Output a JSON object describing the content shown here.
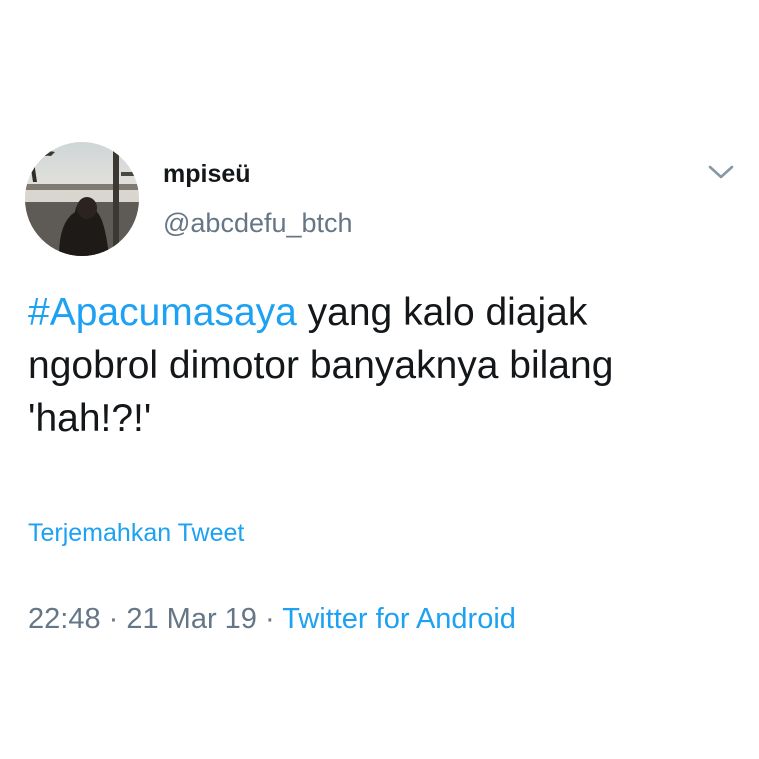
{
  "tweet": {
    "author": {
      "display_name": "mpiseü",
      "handle": "@abcdefu_btch"
    },
    "menu_icon": "chevron-down-icon",
    "text": {
      "hashtag": "#Apacumasaya",
      "body": " yang kalo diajak\nngobrol dimotor banyaknya bilang\n'hah!?!'"
    },
    "translate_label": "Terjemahkan Tweet",
    "time": "22:48",
    "separator": " · ",
    "date": "21 Mar 19",
    "source": "Twitter for Android"
  },
  "colors": {
    "link": "#1da1f2",
    "text": "#14171a",
    "secondary": "#657786"
  }
}
